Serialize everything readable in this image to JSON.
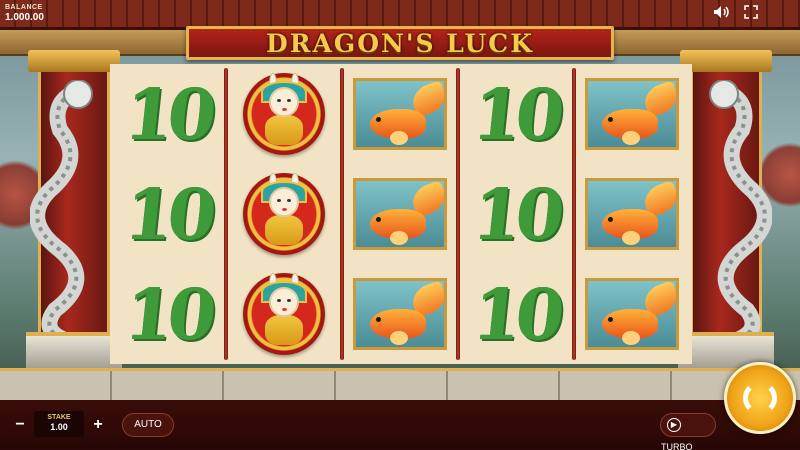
{
  "header": {
    "balance_label": "BALANCE",
    "balance_value": "1.000.00",
    "title": "DRAGON'S LUCK",
    "sound_icon": "speaker-icon",
    "fullscreen_icon": "fullscreen-icon"
  },
  "reels": [
    [
      "10",
      "10",
      "10"
    ],
    [
      "doll",
      "doll",
      "doll"
    ],
    [
      "koi",
      "koi",
      "koi"
    ],
    [
      "10",
      "10",
      "10"
    ],
    [
      "koi",
      "koi",
      "koi"
    ]
  ],
  "controls": {
    "minus": "−",
    "plus": "+",
    "stake_label": "STAKE",
    "stake_value": "1.00",
    "auto_label": "AUTO",
    "turbo_label": "TURBO",
    "spin_icon": "spin-arrows-icon"
  },
  "colors": {
    "ten_green": "#3f9a3a",
    "title_gold": "#f6c94a",
    "banner_red": "#b3241a",
    "spin_gold": "#f0a318"
  }
}
